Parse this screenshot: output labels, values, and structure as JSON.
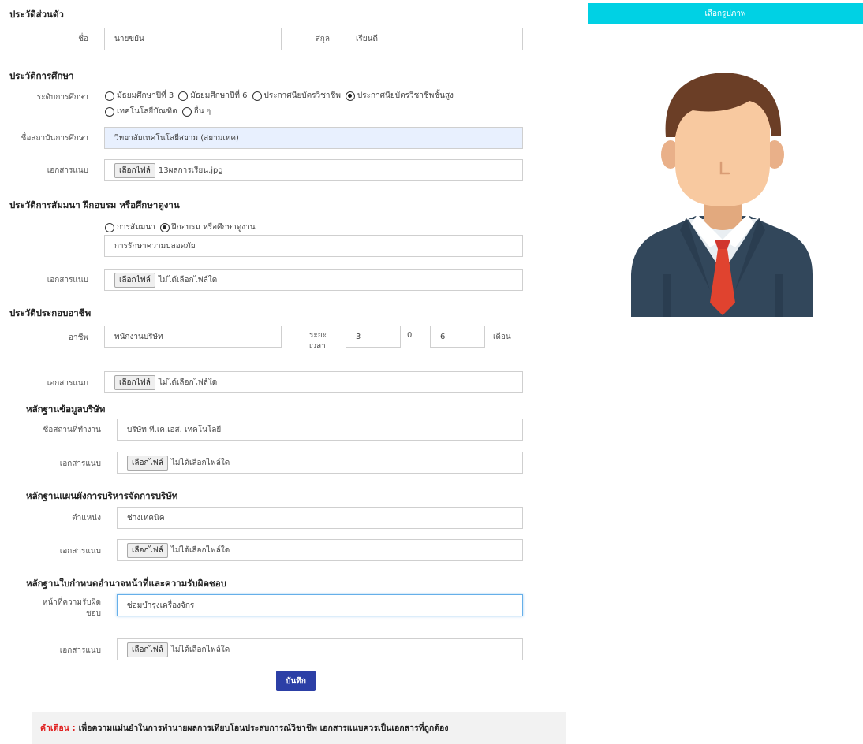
{
  "personal": {
    "heading": "ประวัติส่วนตัว",
    "first_name_label": "ชื่อ",
    "first_name_value": "นายขยัน",
    "last_name_label": "สกุล",
    "last_name_value": "เรียนดี"
  },
  "education": {
    "heading": "ประวัติการศึกษา",
    "level_label": "ระดับการศึกษา",
    "levels": [
      {
        "label": "มัธยมศึกษาปีที่ 3",
        "selected": false
      },
      {
        "label": "มัธยมศึกษาปีที่ 6",
        "selected": false
      },
      {
        "label": "ประกาศนียบัตรวิชาชีพ",
        "selected": false
      },
      {
        "label": "ประกาศนียบัตรวิชาชีพชั้นสูง",
        "selected": true
      },
      {
        "label": "เทคโนโลยีบัณฑิต",
        "selected": false
      },
      {
        "label": "อื่น ๆ",
        "selected": false
      }
    ],
    "institution_label": "ชื่อสถาบันการศึกษา",
    "institution_value": "วิทยาลัยเทคโนโลยีสยาม (สยามเทค)",
    "attach_label": "เอกสารแนบ",
    "file_button": "เลือกไฟล์",
    "file_name": "13ผลการเรียน.jpg"
  },
  "training": {
    "heading": "ประวัติการสัมมนา ฝึกอบรม หรือศึกษาดูงาน",
    "options": [
      {
        "label": "การสัมมนา",
        "selected": false
      },
      {
        "label": "ฝึกอบรม หรือศึกษาดูงาน",
        "selected": true
      }
    ],
    "topic_value": "การรักษาความปลอดภัย",
    "attach_label": "เอกสารแนบ",
    "file_button": "เลือกไฟล์",
    "file_name": "ไม่ได้เลือกไฟล์ใด"
  },
  "career": {
    "heading": "ประวัติประกอบอาชีพ",
    "occupation_label": "อาชีพ",
    "occupation_value": "พนักงานบริษัท",
    "duration_label": "ระยะเวลา",
    "years_value": "3",
    "months_value": "0",
    "days_value": "6",
    "unit_label": "เดือน",
    "attach_label": "เอกสารแนบ",
    "file_button": "เลือกไฟล์",
    "file_name": "ไม่ได้เลือกไฟล์ใด"
  },
  "company": {
    "heading": "หลักฐานข้อมูลบริษัท",
    "workplace_label": "ชื่อสถานที่ทำงาน",
    "workplace_value": "บริษัท ที.เค.เอส. เทคโนโลยี",
    "attach_label": "เอกสารแนบ",
    "file_button": "เลือกไฟล์",
    "file_name": "ไม่ได้เลือกไฟล์ใด"
  },
  "org_chart": {
    "heading": "หลักฐานแผนผังการบริหารจัดการบริษัท",
    "position_label": "ตำแหน่ง",
    "position_value": "ช่างเทคนิค",
    "attach_label": "เอกสารแนบ",
    "file_button": "เลือกไฟล์",
    "file_name": "ไม่ได้เลือกไฟล์ใด"
  },
  "duties": {
    "heading": "หลักฐานใบกำหนดอำนาจหน้าที่และความรับผิดชอบ",
    "duty_label": "หน้าที่ความรับผิดชอบ",
    "duty_value": "ซ่อมบำรุงเครื่องจักร",
    "attach_label": "เอกสารแนบ",
    "file_button": "เลือกไฟล์",
    "file_name": "ไม่ได้เลือกไฟล์ใด"
  },
  "actions": {
    "save_label": "บันทึก",
    "choose_picture_label": "เลือกรูปภาพ"
  },
  "warning": {
    "label": "คำเตือน :",
    "text": "เพื่อความแม่นยำในการทำนายผลการเทียบโอนประสบการณ์วิชาชีพ เอกสารแนบควรเป็นเอกสารที่ถูกต้อง"
  },
  "colors": {
    "accent": "#00d1e4",
    "save": "#2c3fa6",
    "warning": "#e02020"
  }
}
